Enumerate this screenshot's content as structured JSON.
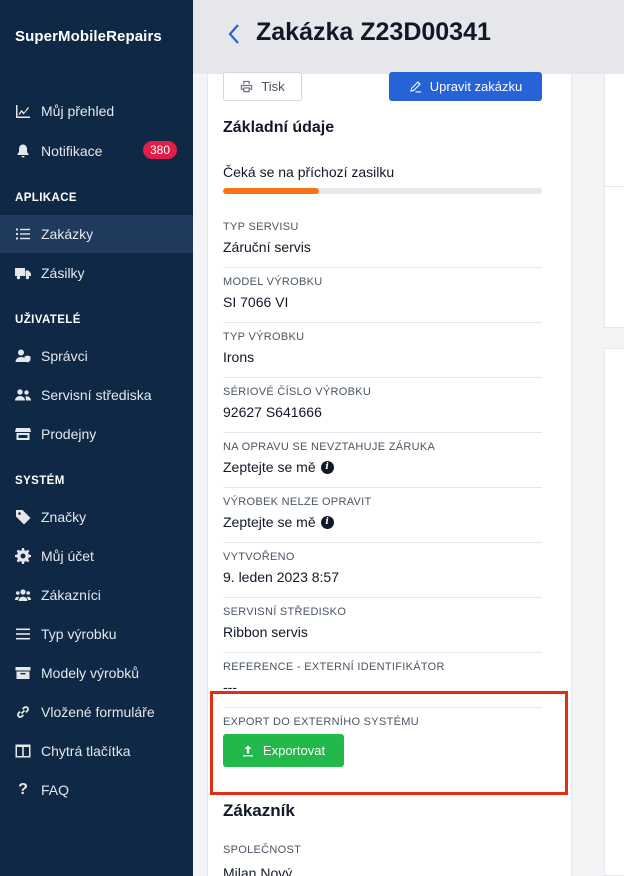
{
  "sidebar": {
    "brand": "SuperMobileRepairs",
    "top_items": [
      {
        "label": "Můj přehled",
        "icon": "chart-line-icon"
      },
      {
        "label": "Notifikace",
        "icon": "bell-icon",
        "badge": "380"
      }
    ],
    "sections": [
      {
        "title": "APLIKACE",
        "items": [
          {
            "label": "Zakázky",
            "icon": "list-icon",
            "active": true
          },
          {
            "label": "Zásilky",
            "icon": "truck-icon"
          }
        ]
      },
      {
        "title": "UŽIVATELÉ",
        "items": [
          {
            "label": "Správci",
            "icon": "user-shield-icon"
          },
          {
            "label": "Servisní střediska",
            "icon": "users-icon"
          },
          {
            "label": "Prodejny",
            "icon": "store-icon"
          }
        ]
      },
      {
        "title": "SYSTÉM",
        "items": [
          {
            "label": "Značky",
            "icon": "tag-icon"
          },
          {
            "label": "Můj účet",
            "icon": "gear-icon"
          },
          {
            "label": "Zákazníci",
            "icon": "user-group-icon"
          },
          {
            "label": "Typ výrobku",
            "icon": "bars-icon"
          },
          {
            "label": "Modely výrobků",
            "icon": "archive-icon"
          },
          {
            "label": "Vložené formuláře",
            "icon": "link-icon"
          },
          {
            "label": "Chytrá tlačítka",
            "icon": "columns-icon"
          },
          {
            "label": "FAQ",
            "icon": "question-icon"
          }
        ]
      }
    ]
  },
  "header": {
    "title": "Zakázka Z23D00341"
  },
  "toolbar": {
    "print_label": "Tisk",
    "edit_label": "Upravit zakázku"
  },
  "basic": {
    "heading": "Základní údaje",
    "status": "Čeká se na příchozí zasilku",
    "progress": 0.3,
    "fields": [
      {
        "label": "TYP SERVISU",
        "value": "Záruční servis"
      },
      {
        "label": "MODEL VÝROBKU",
        "value": "SI 7066 VI"
      },
      {
        "label": "TYP VÝROBKU",
        "value": "Irons"
      },
      {
        "label": "SÉRIOVÉ ČÍSLO VÝROBKU",
        "value": "92627 S641666"
      },
      {
        "label": "NA OPRAVU SE NEVZTAHUJE ZÁRUKA",
        "value": "Zeptejte se mě",
        "info": "i"
      },
      {
        "label": "VÝROBEK NELZE OPRAVIT",
        "value": "Zeptejte se mě",
        "info": "i"
      },
      {
        "label": "VYTVOŘENO",
        "value": "9. leden 2023 8:57"
      },
      {
        "label": "SERVISNÍ STŘEDISKO",
        "value": "Ribbon servis"
      },
      {
        "label": "REFERENCE - EXTERNÍ IDENTIFIKÁTOR",
        "value": "---"
      }
    ],
    "export_label": "EXPORT DO EXTERNÍHO SYSTÉMU",
    "export_button": "Exportovat"
  },
  "customer": {
    "heading": "Zákazník",
    "company_label": "SPOLEČNOST",
    "company_value": "Milan Nový"
  }
}
